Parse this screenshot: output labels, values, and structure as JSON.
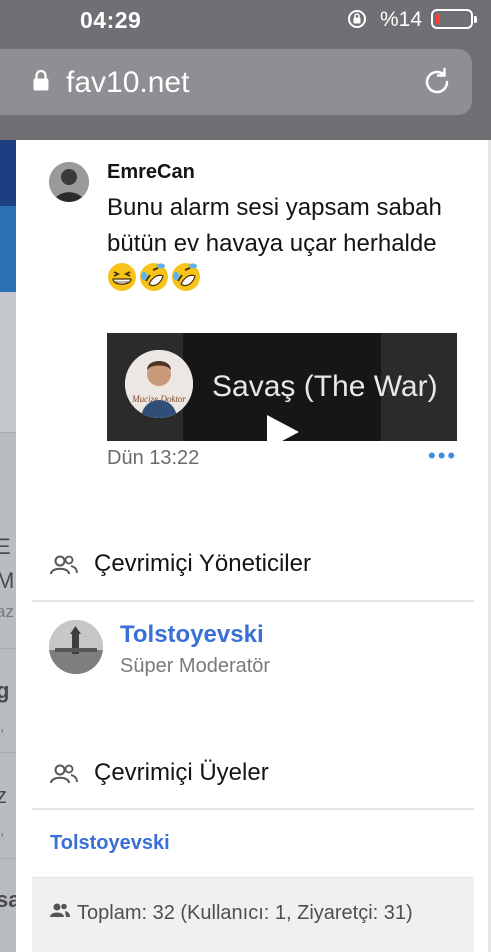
{
  "status_bar": {
    "time": "04:29",
    "battery_text": "%14",
    "battery_level_percent": 14,
    "icons": [
      "rotation-lock-icon",
      "battery-icon"
    ]
  },
  "browser": {
    "url": "fav10.net",
    "icons": [
      "padlock-icon",
      "reload-icon"
    ]
  },
  "background_page": {
    "fragments": [
      "E",
      "M",
      "az",
      "g",
      "l,",
      "z",
      "l,",
      "sa"
    ]
  },
  "post": {
    "username": "EmreCan",
    "message_text": "Bunu alarm sesi yapsam sabah bütün ev havaya uçar herhalde",
    "emojis": [
      "grinning-squinting-face",
      "rolling-on-floor-laughing",
      "rolling-on-floor-laughing"
    ],
    "video": {
      "title": "Savaş (The War)",
      "channel_logo_text": "Mucize Doktor"
    },
    "time": "Dün 13:22",
    "more_label": "•••"
  },
  "online_staff": {
    "heading": "Çevrimiçi Yöneticiler",
    "members": [
      {
        "name": "Tolstoyevski",
        "role": "Süper Moderatör"
      }
    ]
  },
  "online_members": {
    "heading": "Çevrimiçi Üyeler",
    "members": [
      "Tolstoyevski"
    ],
    "totals_text": "Toplam: 32 (Kullanıcı: 1, Ziyaretçi: 31)"
  },
  "colors": {
    "link": "#3b6fd8",
    "more_dots": "#3d8de0",
    "battery_low": "#ff3b30"
  }
}
